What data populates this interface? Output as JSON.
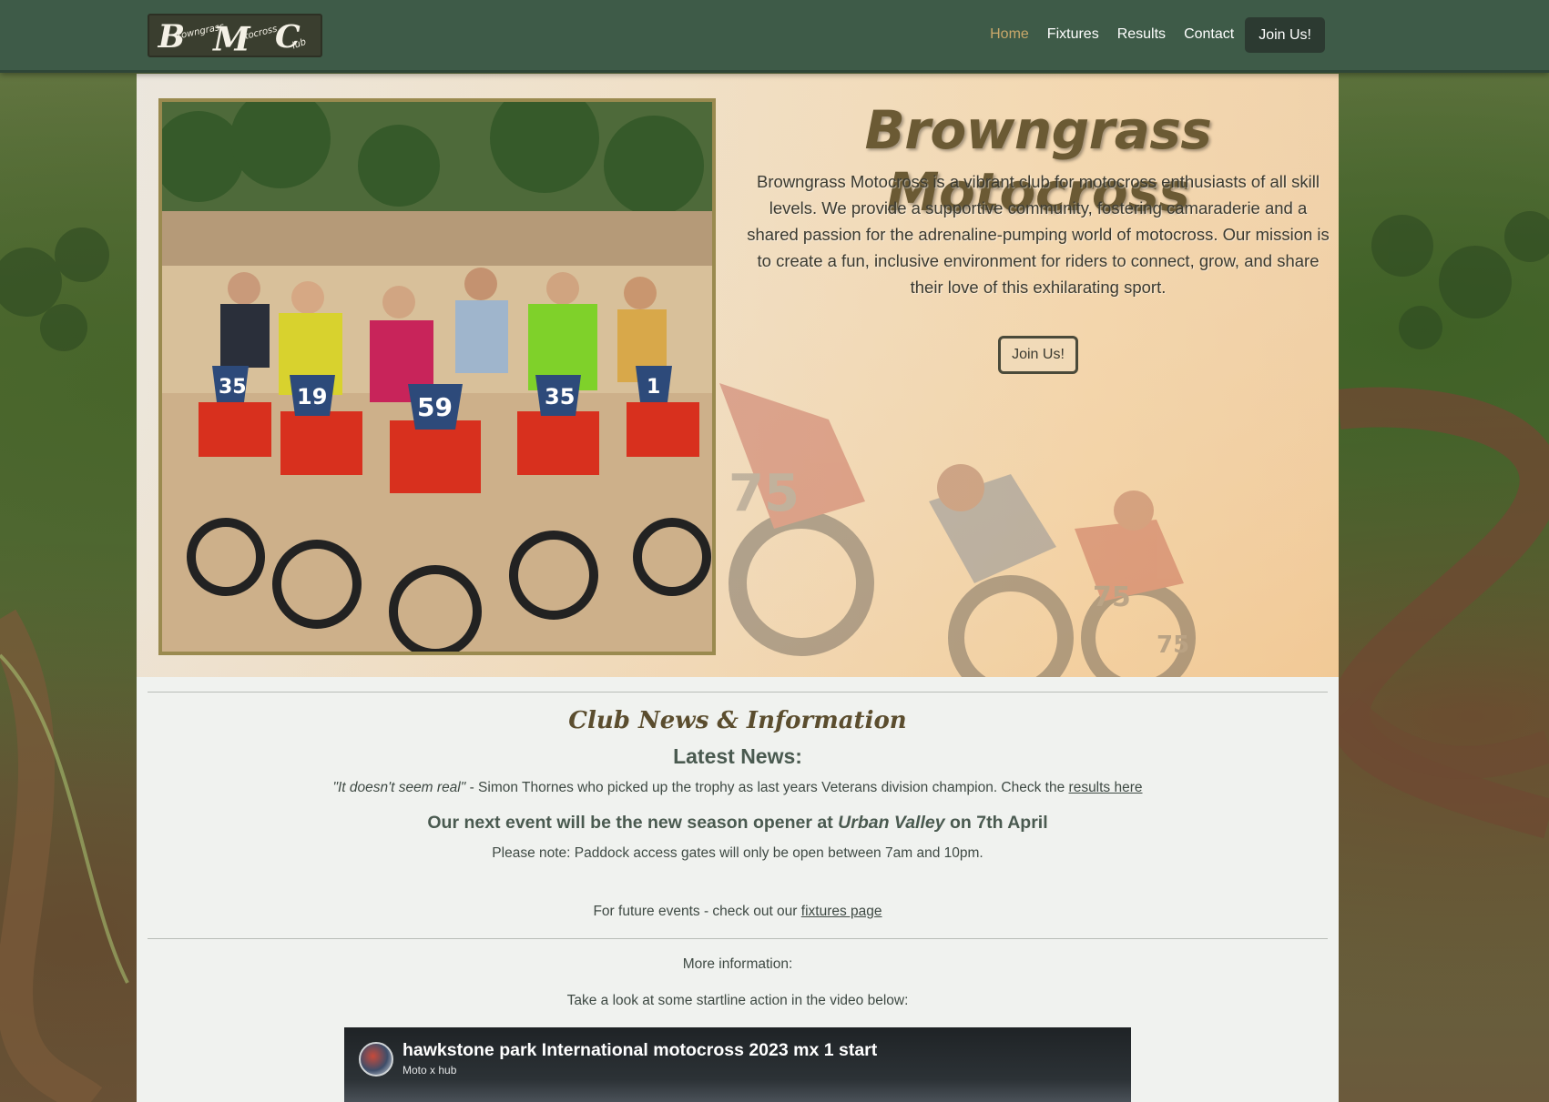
{
  "brand": {
    "logo_text": "BrowngrassMotocrossClub",
    "logo_letters": [
      "B",
      "M",
      "C"
    ],
    "logo_small": [
      "rowngrass",
      "otocross",
      "lub"
    ]
  },
  "nav": {
    "items": [
      {
        "label": "Home",
        "active": true
      },
      {
        "label": "Fixtures",
        "active": false
      },
      {
        "label": "Results",
        "active": false
      },
      {
        "label": "Contact",
        "active": false
      }
    ],
    "join_label": "Join Us!"
  },
  "hero": {
    "title": "Browngrass Motocross",
    "description": "Browngrass Motocross is a vibrant club for motocross enthusiasts of all skill levels. We provide a supportive community, fostering camaraderie and a shared passion for the adrenaline-pumping world of motocross. Our mission is to create a fun, inclusive environment for riders to connect, grow, and share their love of this exhilarating sport.",
    "join_label": "Join Us!"
  },
  "news": {
    "heading": "Club News & Information",
    "latest_heading": "Latest News:",
    "quote": "\"It doesn't seem real\"",
    "quote_rest": " - Simon Thornes who picked up the trophy as last years Veterans division champion. Check the ",
    "results_link": "results here",
    "event_prefix": "Our next event will be the new season opener at ",
    "event_venue": "Urban Valley",
    "event_suffix": " on 7th April",
    "note": "Please note: Paddock access gates will only be open between 7am and 10pm.",
    "future_prefix": "For future events - check out our ",
    "fixtures_link": "fixtures page",
    "more_info": "More information:",
    "video_intro": "Take a look at some startline action in the video below:"
  },
  "video": {
    "title": "hawkstone park International motocross 2023 mx 1 start",
    "channel": "Moto x hub"
  },
  "colors": {
    "nav_bg": "#3e5b48",
    "nav_active": "#c9a86a",
    "title": "#6b5a34",
    "photo_border": "#9a8a4f"
  }
}
